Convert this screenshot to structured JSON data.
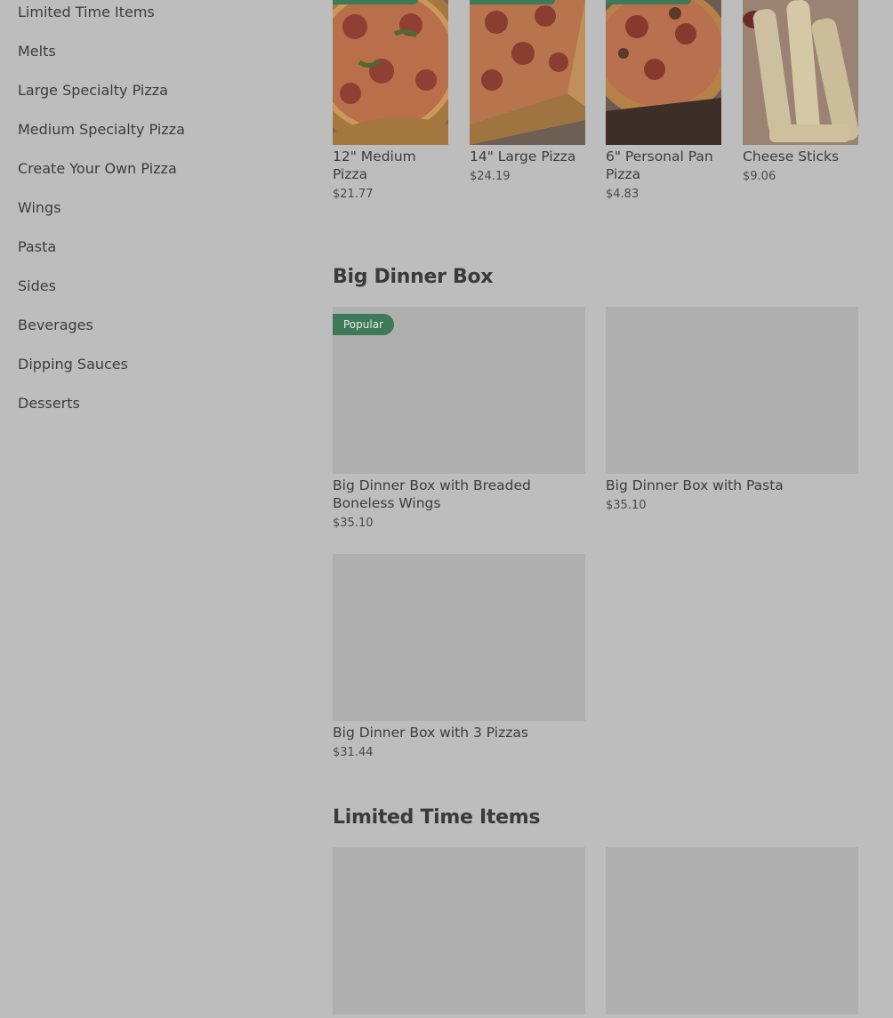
{
  "sidebar": {
    "categories": [
      "Limited Time Items",
      "Melts",
      "Large Specialty Pizza",
      "Medium Specialty Pizza",
      "Create Your Own Pizza",
      "Wings",
      "Pasta",
      "Sides",
      "Beverages",
      "Dipping Sauces",
      "Desserts"
    ]
  },
  "top_items": [
    {
      "name_line1": "12\" Medium",
      "name_line2": "Pizza",
      "price": "$21.77"
    },
    {
      "name_line1": "14\" Large Pizza",
      "name_line2": "",
      "price": "$24.19"
    },
    {
      "name_line1": "6\" Personal Pan",
      "name_line2": "Pizza",
      "price": "$4.83"
    },
    {
      "name_line1": "Cheese Sticks",
      "name_line2": "",
      "price": "$9.06"
    }
  ],
  "big_dinner_box": {
    "title": "Big Dinner Box",
    "badge": "Popular",
    "items": [
      {
        "name_line1": "Big Dinner Box with Breaded",
        "name_line2": "Boneless Wings",
        "price": "$35.10"
      },
      {
        "name_line1": "Big Dinner Box with Pasta",
        "name_line2": "",
        "price": "$35.10"
      },
      {
        "name_line1": "Big Dinner Box with 3 Pizzas",
        "name_line2": "",
        "price": "$31.44"
      }
    ]
  },
  "limited_time": {
    "title": "Limited Time Items"
  },
  "colors": {
    "overlay_bg": "#bdbdbd",
    "badge_green": "#3f7a58",
    "placeholder": "#afafaf"
  }
}
